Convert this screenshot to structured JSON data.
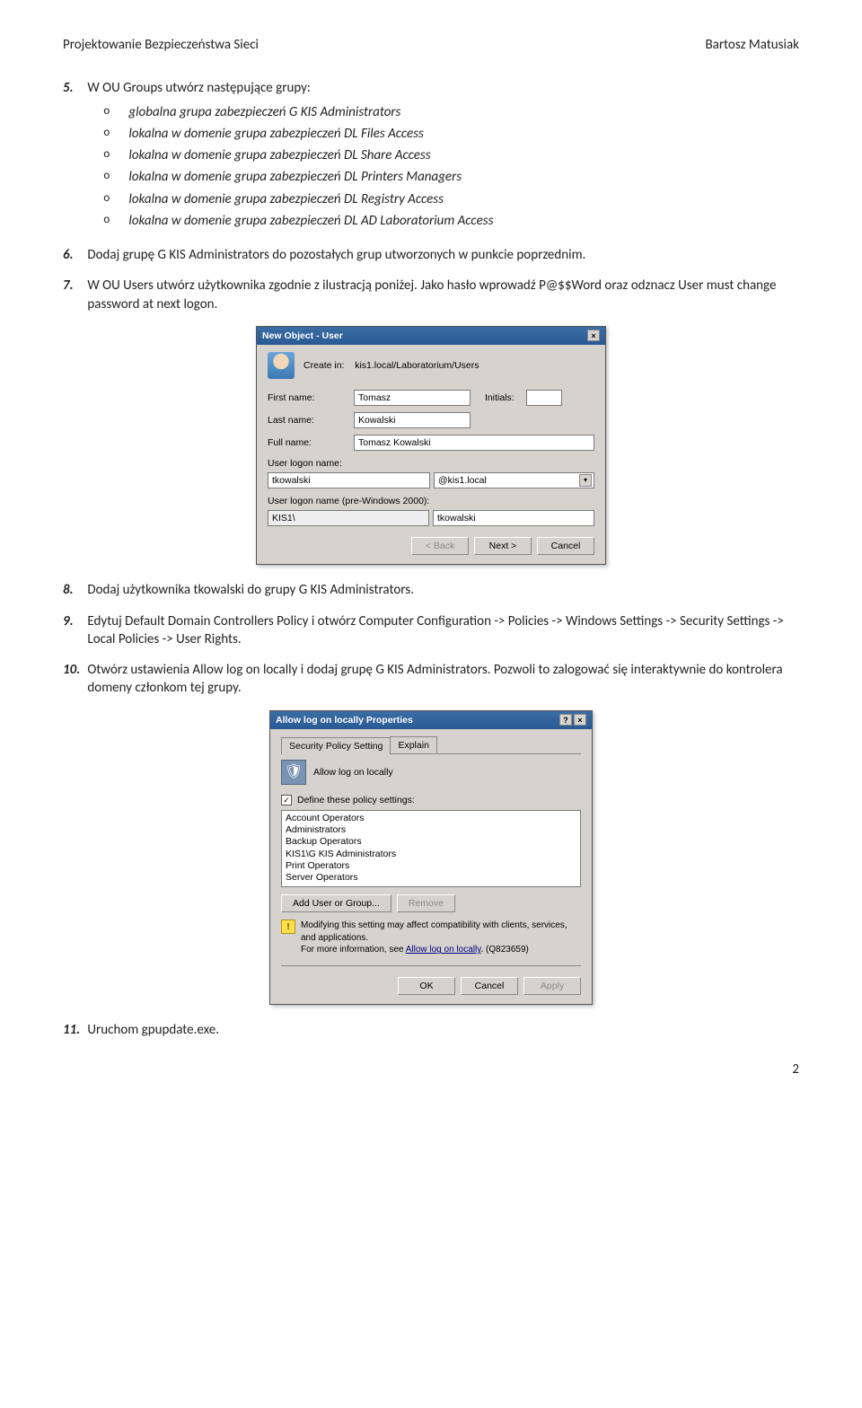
{
  "header": {
    "left": "Projektowanie Bezpieczeństwa Sieci",
    "right": "Bartosz Matusiak"
  },
  "items": {
    "5": {
      "lead": "W OU Groups utwórz następujące grupy:",
      "bullets": [
        "globalna grupa zabezpieczeń G KIS Administrators",
        "lokalna w domenie grupa zabezpieczeń DL Files Access",
        "lokalna w domenie grupa zabezpieczeń DL Share Access",
        "lokalna w domenie grupa zabezpieczeń DL Printers Managers",
        "lokalna w domenie grupa zabezpieczeń DL Registry Access",
        "lokalna w domenie grupa zabezpieczeń DL AD Laboratorium Access"
      ]
    },
    "6": "Dodaj grupę G KIS Administrators do pozostałych grup utworzonych w punkcie poprzednim.",
    "7a": "W OU Users utwórz użytkownika zgodnie z ilustracją poniżej. Jako hasło wprowadź P@$$Word oraz odznacz User must change password at next logon.",
    "8": "Dodaj użytkownika tkowalski do grupy G KIS Administrators.",
    "9": "Edytuj Default Domain Controllers Policy i otwórz Computer Configuration -> Policies -> Windows Settings -> Security Settings -> Local Policies -> User Rights.",
    "10": "Otwórz ustawienia Allow log on locally i dodaj grupę G KIS Administrators. Pozwoli to zalogować się interaktywnie do kontrolera domeny członkom tej grupy.",
    "11": "Uruchom gpupdate.exe."
  },
  "nums": {
    "5": "5.",
    "6": "6.",
    "7": "7.",
    "8": "8.",
    "9": "9.",
    "10": "10.",
    "11": "11."
  },
  "newUser": {
    "title": "New Object - User",
    "createInLabel": "Create in:",
    "createIn": "kis1.local/Laboratorium/Users",
    "firstNameLabel": "First name:",
    "firstName": "Tomasz",
    "initialsLabel": "Initials:",
    "initials": "",
    "lastNameLabel": "Last name:",
    "lastName": "Kowalski",
    "fullNameLabel": "Full name:",
    "fullName": "Tomasz Kowalski",
    "logonLabel": "User logon name:",
    "logon": "tkowalski",
    "logonSuffix": "@kis1.local",
    "preLabel": "User logon name (pre-Windows 2000):",
    "preDomain": "KIS1\\",
    "preUser": "tkowalski",
    "back": "< Back",
    "next": "Next >",
    "cancel": "Cancel"
  },
  "policy": {
    "title": "Allow log on locally Properties",
    "tab1": "Security Policy Setting",
    "tab2": "Explain",
    "policyName": "Allow log on locally",
    "defineLabel": "Define these policy settings:",
    "listItems": [
      "Account Operators",
      "Administrators",
      "Backup Operators",
      "KIS1\\G KIS Administrators",
      "Print Operators",
      "Server Operators"
    ],
    "addBtn": "Add User or Group...",
    "removeBtn": "Remove",
    "noteText1": "Modifying this setting may affect compatibility with clients, services, and applications.",
    "noteText2a": "For more information, see ",
    "noteLink": "Allow log on locally",
    "noteText2b": ". (Q823659)",
    "ok": "OK",
    "cancel": "Cancel",
    "apply": "Apply"
  },
  "footer": {
    "page": "2"
  }
}
